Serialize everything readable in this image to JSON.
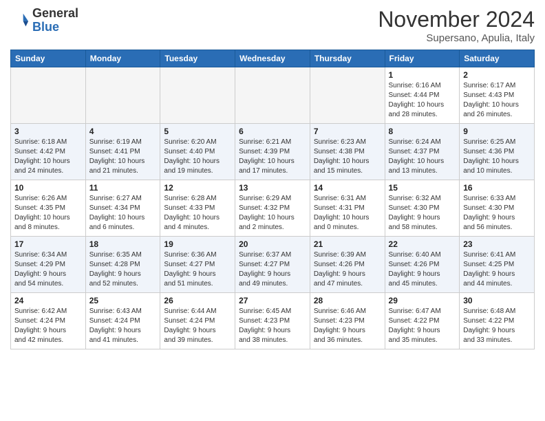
{
  "header": {
    "logo_general": "General",
    "logo_blue": "Blue",
    "month_title": "November 2024",
    "location": "Supersano, Apulia, Italy"
  },
  "days_of_week": [
    "Sunday",
    "Monday",
    "Tuesday",
    "Wednesday",
    "Thursday",
    "Friday",
    "Saturday"
  ],
  "weeks": [
    [
      {
        "day": "",
        "info": "",
        "empty": true
      },
      {
        "day": "",
        "info": "",
        "empty": true
      },
      {
        "day": "",
        "info": "",
        "empty": true
      },
      {
        "day": "",
        "info": "",
        "empty": true
      },
      {
        "day": "",
        "info": "",
        "empty": true
      },
      {
        "day": "1",
        "info": "Sunrise: 6:16 AM\nSunset: 4:44 PM\nDaylight: 10 hours\nand 28 minutes."
      },
      {
        "day": "2",
        "info": "Sunrise: 6:17 AM\nSunset: 4:43 PM\nDaylight: 10 hours\nand 26 minutes."
      }
    ],
    [
      {
        "day": "3",
        "info": "Sunrise: 6:18 AM\nSunset: 4:42 PM\nDaylight: 10 hours\nand 24 minutes."
      },
      {
        "day": "4",
        "info": "Sunrise: 6:19 AM\nSunset: 4:41 PM\nDaylight: 10 hours\nand 21 minutes."
      },
      {
        "day": "5",
        "info": "Sunrise: 6:20 AM\nSunset: 4:40 PM\nDaylight: 10 hours\nand 19 minutes."
      },
      {
        "day": "6",
        "info": "Sunrise: 6:21 AM\nSunset: 4:39 PM\nDaylight: 10 hours\nand 17 minutes."
      },
      {
        "day": "7",
        "info": "Sunrise: 6:23 AM\nSunset: 4:38 PM\nDaylight: 10 hours\nand 15 minutes."
      },
      {
        "day": "8",
        "info": "Sunrise: 6:24 AM\nSunset: 4:37 PM\nDaylight: 10 hours\nand 13 minutes."
      },
      {
        "day": "9",
        "info": "Sunrise: 6:25 AM\nSunset: 4:36 PM\nDaylight: 10 hours\nand 10 minutes."
      }
    ],
    [
      {
        "day": "10",
        "info": "Sunrise: 6:26 AM\nSunset: 4:35 PM\nDaylight: 10 hours\nand 8 minutes."
      },
      {
        "day": "11",
        "info": "Sunrise: 6:27 AM\nSunset: 4:34 PM\nDaylight: 10 hours\nand 6 minutes."
      },
      {
        "day": "12",
        "info": "Sunrise: 6:28 AM\nSunset: 4:33 PM\nDaylight: 10 hours\nand 4 minutes."
      },
      {
        "day": "13",
        "info": "Sunrise: 6:29 AM\nSunset: 4:32 PM\nDaylight: 10 hours\nand 2 minutes."
      },
      {
        "day": "14",
        "info": "Sunrise: 6:31 AM\nSunset: 4:31 PM\nDaylight: 10 hours\nand 0 minutes."
      },
      {
        "day": "15",
        "info": "Sunrise: 6:32 AM\nSunset: 4:30 PM\nDaylight: 9 hours\nand 58 minutes."
      },
      {
        "day": "16",
        "info": "Sunrise: 6:33 AM\nSunset: 4:30 PM\nDaylight: 9 hours\nand 56 minutes."
      }
    ],
    [
      {
        "day": "17",
        "info": "Sunrise: 6:34 AM\nSunset: 4:29 PM\nDaylight: 9 hours\nand 54 minutes."
      },
      {
        "day": "18",
        "info": "Sunrise: 6:35 AM\nSunset: 4:28 PM\nDaylight: 9 hours\nand 52 minutes."
      },
      {
        "day": "19",
        "info": "Sunrise: 6:36 AM\nSunset: 4:27 PM\nDaylight: 9 hours\nand 51 minutes."
      },
      {
        "day": "20",
        "info": "Sunrise: 6:37 AM\nSunset: 4:27 PM\nDaylight: 9 hours\nand 49 minutes."
      },
      {
        "day": "21",
        "info": "Sunrise: 6:39 AM\nSunset: 4:26 PM\nDaylight: 9 hours\nand 47 minutes."
      },
      {
        "day": "22",
        "info": "Sunrise: 6:40 AM\nSunset: 4:26 PM\nDaylight: 9 hours\nand 45 minutes."
      },
      {
        "day": "23",
        "info": "Sunrise: 6:41 AM\nSunset: 4:25 PM\nDaylight: 9 hours\nand 44 minutes."
      }
    ],
    [
      {
        "day": "24",
        "info": "Sunrise: 6:42 AM\nSunset: 4:24 PM\nDaylight: 9 hours\nand 42 minutes."
      },
      {
        "day": "25",
        "info": "Sunrise: 6:43 AM\nSunset: 4:24 PM\nDaylight: 9 hours\nand 41 minutes."
      },
      {
        "day": "26",
        "info": "Sunrise: 6:44 AM\nSunset: 4:24 PM\nDaylight: 9 hours\nand 39 minutes."
      },
      {
        "day": "27",
        "info": "Sunrise: 6:45 AM\nSunset: 4:23 PM\nDaylight: 9 hours\nand 38 minutes."
      },
      {
        "day": "28",
        "info": "Sunrise: 6:46 AM\nSunset: 4:23 PM\nDaylight: 9 hours\nand 36 minutes."
      },
      {
        "day": "29",
        "info": "Sunrise: 6:47 AM\nSunset: 4:22 PM\nDaylight: 9 hours\nand 35 minutes."
      },
      {
        "day": "30",
        "info": "Sunrise: 6:48 AM\nSunset: 4:22 PM\nDaylight: 9 hours\nand 33 minutes."
      }
    ]
  ]
}
